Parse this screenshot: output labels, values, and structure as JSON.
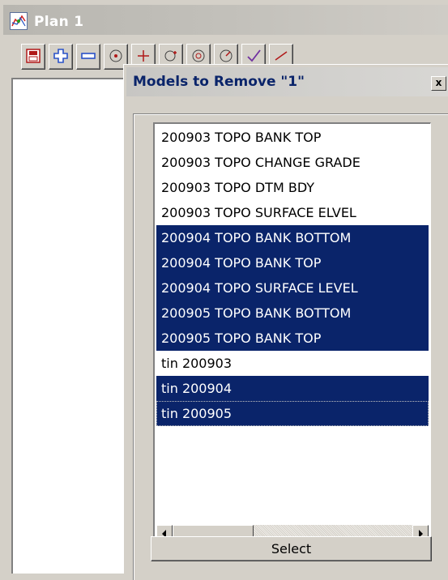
{
  "plan_window": {
    "title": "Plan 1",
    "toolbar_icons": [
      "save-plot-icon",
      "zoom-in-plus-icon",
      "zoom-out-minus-icon",
      "zoom-fit-icon",
      "pan-icon",
      "zoom-extent-icon",
      "view-icon",
      "rotate-icon",
      "check-icon",
      "measure-icon"
    ]
  },
  "dialog": {
    "title": "Models to Remove \"1\"",
    "close_label": "x",
    "models": [
      {
        "label": "200903 TOPO BANK TOP",
        "selected": false
      },
      {
        "label": "200903 TOPO CHANGE GRADE",
        "selected": false
      },
      {
        "label": "200903 TOPO DTM BDY",
        "selected": false
      },
      {
        "label": "200903 TOPO SURFACE ELVEL",
        "selected": false
      },
      {
        "label": "200904 TOPO BANK BOTTOM",
        "selected": true
      },
      {
        "label": "200904 TOPO BANK TOP",
        "selected": true
      },
      {
        "label": "200904 TOPO SURFACE LEVEL",
        "selected": true
      },
      {
        "label": "200905 TOPO BANK BOTTOM",
        "selected": true
      },
      {
        "label": "200905 TOPO BANK TOP",
        "selected": true
      },
      {
        "label": "tin 200903",
        "selected": false
      },
      {
        "label": "tin 200904",
        "selected": true
      },
      {
        "label": "tin 200905",
        "selected": true,
        "focused": true
      }
    ],
    "scrollbar": {
      "left_arrow": "left-arrow-icon",
      "right_arrow": "right-arrow-icon"
    },
    "select_label": "Select"
  },
  "colors": {
    "selection": "#0a246a",
    "window_face": "#d4d0c8",
    "title_text": "#0a246a"
  }
}
